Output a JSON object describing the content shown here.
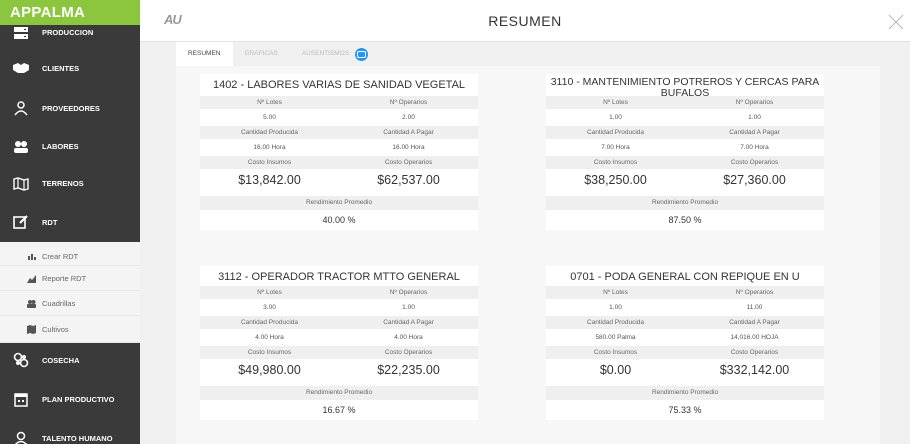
{
  "brand": "APPALMA",
  "header": {
    "logo": "AU",
    "title": "RESUMEN"
  },
  "sidebar": {
    "items": [
      {
        "label": "PRODUCCION",
        "icon": "server-icon"
      },
      {
        "label": "CLIENTES",
        "icon": "handshake-icon"
      },
      {
        "label": "PROVEEDORES",
        "icon": "users-icon"
      },
      {
        "label": "LABORES",
        "icon": "group-icon"
      },
      {
        "label": "TERRENOS",
        "icon": "map-icon"
      },
      {
        "label": "RDT",
        "icon": "edit-icon"
      }
    ],
    "subitems": [
      {
        "label": "Crear RDT",
        "icon": "bar-chart-icon"
      },
      {
        "label": "Reporte RDT",
        "icon": "area-chart-icon"
      },
      {
        "label": "Cuadrillas",
        "icon": "group-icon"
      },
      {
        "label": "Cultivos",
        "icon": "map-icon"
      }
    ],
    "bottom_items": [
      {
        "label": "COSECHA",
        "icon": "cosecha-icon"
      },
      {
        "label": "PLAN PRODUCTIVO",
        "icon": "calendar-icon"
      },
      {
        "label": "TALENTO HUMANO",
        "icon": "person-icon"
      }
    ]
  },
  "tabs": [
    "RESUMEN",
    "GRAFICAS",
    "AUSENTISMOS"
  ],
  "labels": {
    "lotes": "Nº Lotes",
    "operarios": "Nº Operarios",
    "cantidad_producida": "Cantidad Producida",
    "cantidad_pagar": "Cantidad A Pagar",
    "costo_insumos": "Costo Insumos",
    "costo_operarios": "Costo Operarios",
    "rendimiento": "Rendimiento Promedio"
  },
  "cards": [
    {
      "title": "1402 - LABORES VARIAS DE SANIDAD VEGETAL",
      "lotes": "5.00",
      "operarios": "2.00",
      "cantidad_producida": "16.00 Hora",
      "cantidad_pagar": "16.00 Hora",
      "costo_insumos": "$13,842.00",
      "costo_operarios": "$62,537.00",
      "rendimiento": "40.00 %"
    },
    {
      "title": "3110 - MANTENIMIENTO POTREROS Y CERCAS PARA BUFALOS",
      "lotes": "1.00",
      "operarios": "1.00",
      "cantidad_producida": "7.00 Hora",
      "cantidad_pagar": "7.00 Hora",
      "costo_insumos": "$38,250.00",
      "costo_operarios": "$27,360.00",
      "rendimiento": "87.50 %"
    },
    {
      "title": "3112 - OPERADOR TRACTOR MTTO GENERAL",
      "lotes": "3.00",
      "operarios": "1.00",
      "cantidad_producida": "4.00 Hora",
      "cantidad_pagar": "4.00 Hora",
      "costo_insumos": "$49,980.00",
      "costo_operarios": "$22,235.00",
      "rendimiento": "16.67 %"
    },
    {
      "title": "0701 - PODA GENERAL CON REPIQUE EN U",
      "lotes": "1.00",
      "operarios": "11.00",
      "cantidad_producida": "580.00 Palma",
      "cantidad_pagar": "14,016.00 HOJA",
      "costo_insumos": "$0.00",
      "costo_operarios": "$332,142.00",
      "rendimiento": "75.33 %"
    }
  ]
}
